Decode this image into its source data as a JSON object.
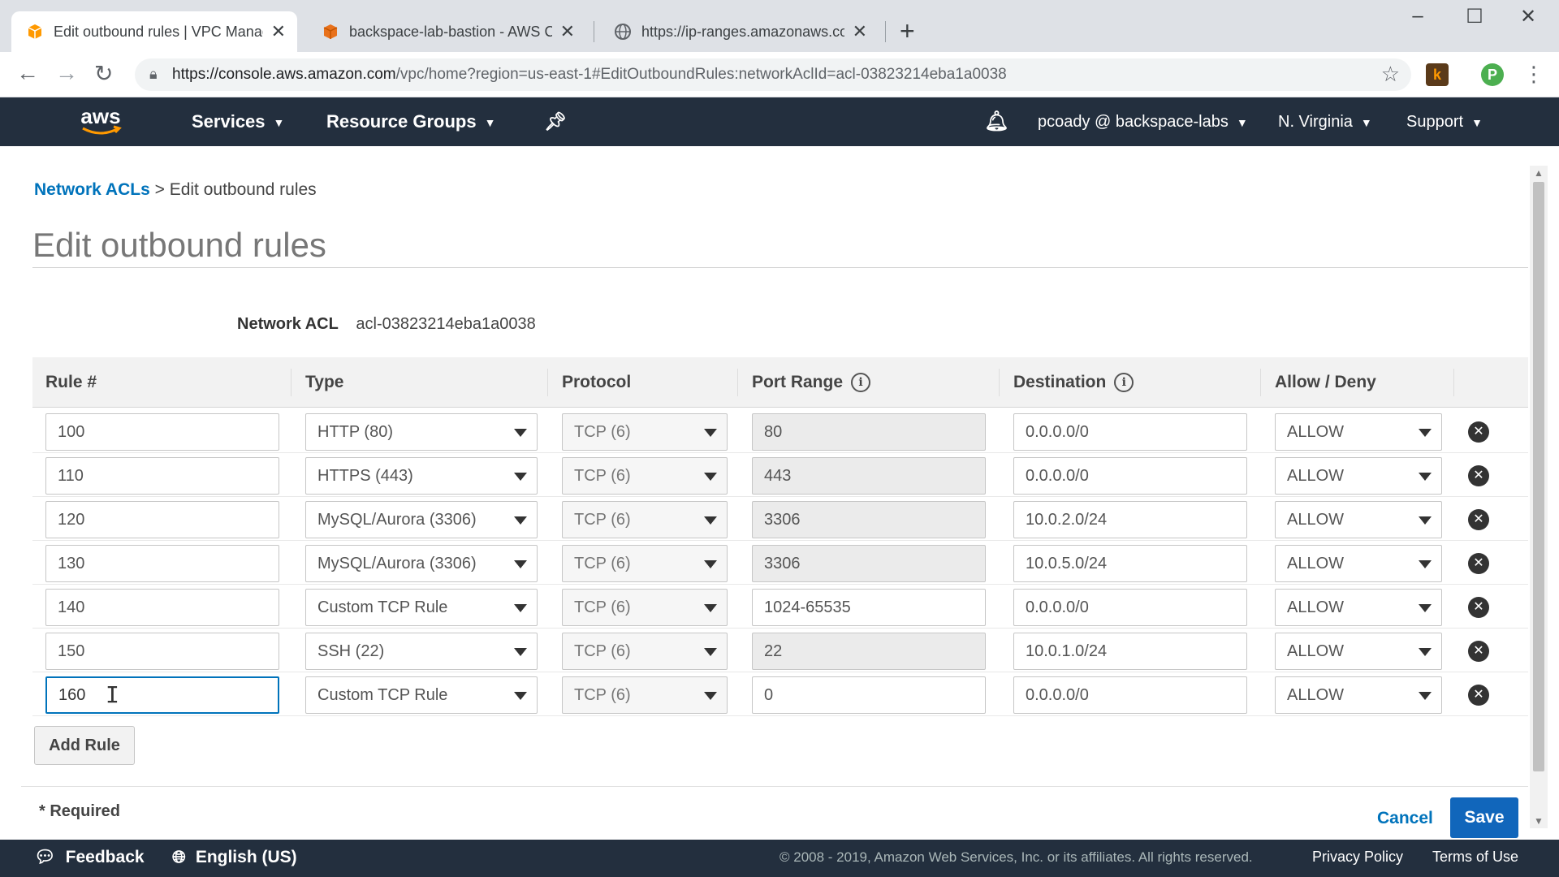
{
  "browser": {
    "tabs": [
      {
        "title": "Edit outbound rules | VPC Manag",
        "active": true,
        "icon": "aws-box-icon"
      },
      {
        "title": "backspace-lab-bastion - AWS Clo",
        "active": false,
        "icon": "aws-cube-icon"
      },
      {
        "title": "https://ip-ranges.amazonaws.com",
        "active": false,
        "icon": "globe-icon"
      }
    ],
    "url_host": "https://console.aws.amazon.com",
    "url_path": "/vpc/home?region=us-east-1#EditOutboundRules:networkAclId=acl-03823214eba1a0038",
    "extension_labels": [
      "k",
      "P"
    ]
  },
  "aws_nav": {
    "logo": "aws",
    "services": "Services",
    "resource_groups": "Resource Groups",
    "user": "pcoady @ backspace-labs",
    "region": "N. Virginia",
    "support": "Support"
  },
  "breadcrumb": {
    "parent": "Network ACLs",
    "separator": ">",
    "current": "Edit outbound rules"
  },
  "page": {
    "title": "Edit outbound rules",
    "acl_label": "Network ACL",
    "acl_id": "acl-03823214eba1a0038"
  },
  "table": {
    "headers": {
      "rule": "Rule #",
      "type": "Type",
      "protocol": "Protocol",
      "port_range": "Port Range",
      "destination": "Destination",
      "action": "Allow / Deny"
    },
    "rows": [
      {
        "rule": "100",
        "type": "HTTP (80)",
        "protocol": "TCP (6)",
        "port": "80",
        "port_editable": false,
        "destination": "0.0.0.0/0",
        "action": "ALLOW"
      },
      {
        "rule": "110",
        "type": "HTTPS (443)",
        "protocol": "TCP (6)",
        "port": "443",
        "port_editable": false,
        "destination": "0.0.0.0/0",
        "action": "ALLOW"
      },
      {
        "rule": "120",
        "type": "MySQL/Aurora (3306)",
        "protocol": "TCP (6)",
        "port": "3306",
        "port_editable": false,
        "destination": "10.0.2.0/24",
        "action": "ALLOW"
      },
      {
        "rule": "130",
        "type": "MySQL/Aurora (3306)",
        "protocol": "TCP (6)",
        "port": "3306",
        "port_editable": false,
        "destination": "10.0.5.0/24",
        "action": "ALLOW"
      },
      {
        "rule": "140",
        "type": "Custom TCP Rule",
        "protocol": "TCP (6)",
        "port": "1024-65535",
        "port_editable": true,
        "destination": "0.0.0.0/0",
        "action": "ALLOW"
      },
      {
        "rule": "150",
        "type": "SSH (22)",
        "protocol": "TCP (6)",
        "port": "22",
        "port_editable": false,
        "destination": "10.0.1.0/24",
        "action": "ALLOW"
      },
      {
        "rule": "160",
        "type": "Custom TCP Rule",
        "protocol": "TCP (6)",
        "port": "0",
        "port_editable": true,
        "destination": "0.0.0.0/0",
        "action": "ALLOW",
        "focused": true
      }
    ]
  },
  "actions": {
    "add_rule": "Add Rule",
    "required": "* Required",
    "cancel": "Cancel",
    "save": "Save"
  },
  "footer": {
    "feedback": "Feedback",
    "language": "English (US)",
    "copyright": "© 2008 - 2019, Amazon Web Services, Inc. or its affiliates. All rights reserved.",
    "privacy": "Privacy Policy",
    "terms": "Terms of Use"
  },
  "colors": {
    "aws_nav_bg": "#232f3e",
    "link": "#0073bb",
    "save_bg": "#1166bb",
    "aws_orange": "#ff9900"
  }
}
